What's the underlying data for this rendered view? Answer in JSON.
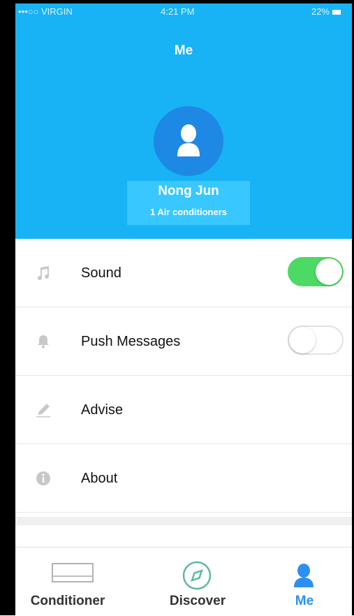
{
  "status": {
    "carrier": "•••○○ VIRGIN",
    "time": "4:21 PM",
    "battery": "22%"
  },
  "header": {
    "title": "Me",
    "user_name": "Nong Jun",
    "subtitle": "1 Air conditioners",
    "avatar_icon": "user-avatar-icon"
  },
  "menu": {
    "items": [
      {
        "label": "Sound",
        "icon": "music-note-icon",
        "toggle": true
      },
      {
        "label": "Push Messages",
        "icon": "bell-icon",
        "toggle": false
      },
      {
        "label": "Advise",
        "icon": "pencil-icon"
      },
      {
        "label": "About",
        "icon": "info-icon"
      }
    ]
  },
  "tabbar": {
    "tabs": [
      {
        "label": "Conditioner",
        "icon": "air-conditioner-icon",
        "active": false
      },
      {
        "label": "Discover",
        "icon": "compass-icon",
        "active": false
      },
      {
        "label": "Me",
        "icon": "person-icon",
        "active": true
      }
    ],
    "active_color": "#2f8ff0"
  },
  "colors": {
    "header_bg": "#18b3f5",
    "avatar_bg": "#1e88e5",
    "toggle_on": "#4cd964"
  }
}
